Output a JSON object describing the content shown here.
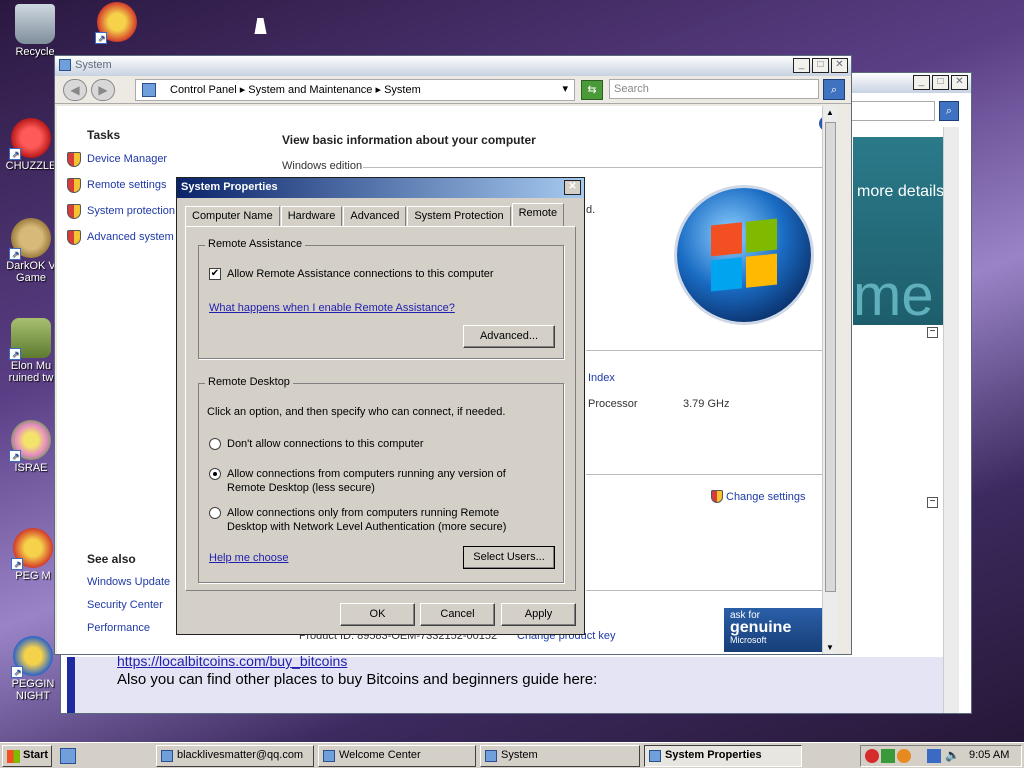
{
  "colors": {
    "accent_blue": "#1f3aa7",
    "dialog_title": "#0a246a",
    "dialog_bg": "#d4d0c8",
    "welcome_teal": "#2a7a8a"
  },
  "desktop": {
    "icons": [
      "Recycle",
      "CHUZZLE",
      "DarkOK V Game",
      "Elon Mu ruined tw",
      "ISRAE",
      "PEG M",
      "PEGGIN NIGHT"
    ]
  },
  "bg_window": {
    "teal_text": "more details",
    "big_text": "me",
    "link_text": "https://localbitcoins.com/buy_bitcoins",
    "bottom_text": "Also you can find other places to buy Bitcoins and beginners guide here:"
  },
  "system_window": {
    "title": "System",
    "address": {
      "root": "Control Panel",
      "sep1": "System and Maintenance",
      "sep2": "System"
    },
    "search_placeholder": "Search",
    "tasks_heading": "Tasks",
    "tasks": [
      "Device Manager",
      "Remote settings",
      "System protection",
      "Advanced system s"
    ],
    "see_also_heading": "See also",
    "see_also": [
      "Windows Update",
      "Security Center",
      "Performance"
    ],
    "main_heading": "View basic information about your computer",
    "edition_label": "Windows edition",
    "partial_d": "d.",
    "index_text": "Index",
    "processor_label": "Processor",
    "processor_value": "3.79 GHz",
    "change_settings": "Change settings",
    "product_id_partial": "Product ID: 89583-OEM-7332152-00152",
    "change_product_key": "Change product key",
    "genuine": {
      "line1": "ask for",
      "line2": "genuine",
      "line3": "Microsoft"
    }
  },
  "dialog": {
    "title": "System Properties",
    "tabs": [
      "Computer Name",
      "Hardware",
      "Advanced",
      "System Protection",
      "Remote"
    ],
    "selected_tab": "Remote",
    "ra_legend": "Remote Assistance",
    "ra_checkbox": "Allow Remote Assistance connections to this computer",
    "ra_checked": true,
    "ra_link": "What happens when I enable Remote Assistance?",
    "ra_advanced": "Advanced...",
    "rd_legend": "Remote Desktop",
    "rd_intro": "Click an option, and then specify who can connect, if needed.",
    "rd_opt1": "Don't allow connections to this computer",
    "rd_opt2a": "Allow connections from computers running any version of",
    "rd_opt2b": "Remote Desktop (less secure)",
    "rd_opt3a": "Allow connections only from computers running Remote",
    "rd_opt3b": "Desktop with Network Level Authentication (more secure)",
    "rd_selected": 2,
    "help_link": "Help me choose",
    "select_users": "Select Users...",
    "ok": "OK",
    "cancel": "Cancel",
    "apply": "Apply"
  },
  "taskbar": {
    "start": "Start",
    "items": [
      "blacklivesmatter@qq.com",
      "Welcome Center",
      "System",
      "System Properties"
    ],
    "active_item": "System Properties",
    "clock": "9:05 AM"
  }
}
